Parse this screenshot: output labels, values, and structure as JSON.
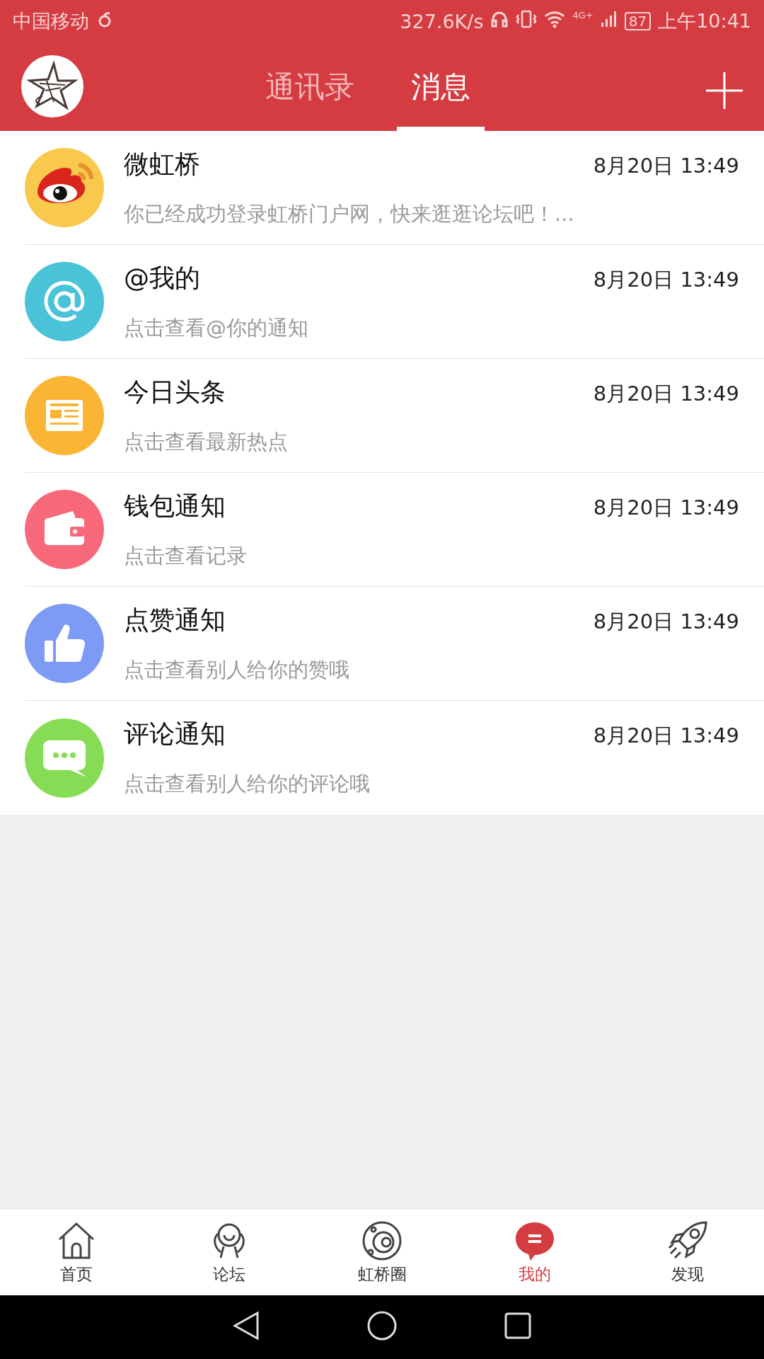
{
  "status_bar": {
    "carrier": "中国移动",
    "speed": "327.6K/s",
    "network": "4G+",
    "battery": "87",
    "time": "上午10:41"
  },
  "header": {
    "tabs": [
      {
        "label": "通讯录",
        "selected": false
      },
      {
        "label": "消息",
        "selected": true
      }
    ]
  },
  "messages": [
    {
      "kind": "weibo",
      "title": "微虹桥",
      "preview": "你已经成功登录虹桥门户网，快来逛逛论坛吧！...",
      "time": "8月20日 13:49"
    },
    {
      "kind": "at",
      "title": "@我的",
      "preview": "点击查看@你的通知",
      "time": "8月20日 13:49"
    },
    {
      "kind": "news",
      "title": "今日头条",
      "preview": "点击查看最新热点",
      "time": "8月20日 13:49"
    },
    {
      "kind": "wallet",
      "title": "钱包通知",
      "preview": "点击查看记录",
      "time": "8月20日 13:49"
    },
    {
      "kind": "like",
      "title": "点赞通知",
      "preview": "点击查看别人给你的赞哦",
      "time": "8月20日 13:49"
    },
    {
      "kind": "comment",
      "title": "评论通知",
      "preview": "点击查看别人给你的评论哦",
      "time": "8月20日 13:49"
    }
  ],
  "bottom_nav": [
    {
      "kind": "home",
      "label": "首页",
      "selected": false
    },
    {
      "kind": "forum",
      "label": "论坛",
      "selected": false
    },
    {
      "kind": "circle",
      "label": "虹桥圈",
      "selected": false
    },
    {
      "kind": "mine",
      "label": "我的",
      "selected": true
    },
    {
      "kind": "discover",
      "label": "发现",
      "selected": false
    }
  ]
}
